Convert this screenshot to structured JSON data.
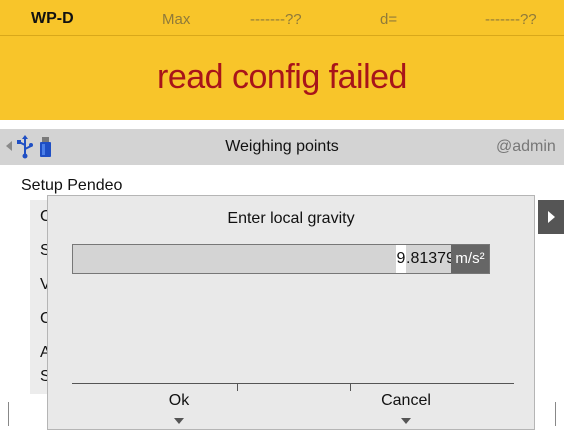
{
  "status": {
    "device": "WP-D",
    "max_label": "Max",
    "max_value": "-------??",
    "d_label": "d=",
    "d_value": "-------??",
    "error": "read config failed",
    "background_color": "#f8c52a",
    "error_color": "#a8141a"
  },
  "nav": {
    "title": "Weighing points",
    "user": "@admin",
    "icons": [
      "back-arrow-icon",
      "usb-icon",
      "usb-stick-icon"
    ]
  },
  "background_screen": {
    "title": "Setup Pendeo",
    "menu_items": [
      "C",
      "S",
      "V",
      "C",
      "A",
      "S"
    ]
  },
  "dialog": {
    "title": "Enter local gravity",
    "input": {
      "cursor_digit": "9",
      "value_rest": ".81379",
      "unit": "m/s²"
    },
    "softkeys": {
      "ok": "Ok",
      "cancel": "Cancel"
    }
  }
}
